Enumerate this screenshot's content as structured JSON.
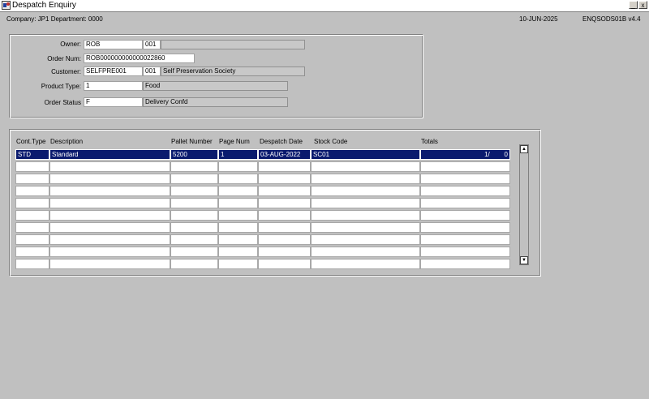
{
  "window": {
    "title": "Despatch Enquiry"
  },
  "status_bar": {
    "company": "Company:  JP1   Department:  0000",
    "date": "10-JUN-2025",
    "program": "ENQSODS01B  v4.4"
  },
  "header": {
    "owner": {
      "label": "Owner:",
      "code": "ROB",
      "num": "001",
      "desc": ""
    },
    "order_num": {
      "label": "Order Num:",
      "value": "ROB000000000000022860"
    },
    "customer": {
      "label": "Customer:",
      "code": "SELFPRE001",
      "num": "001",
      "desc": "Self Preservation Society"
    },
    "product_type": {
      "label": "Product Type:",
      "code": "1",
      "desc": "Food"
    },
    "order_status": {
      "label": "Order Status",
      "code": "F",
      "desc": "Delivery Confd"
    }
  },
  "table": {
    "columns": [
      "Cont.Type",
      "Description",
      "Pallet Number",
      "Page Num",
      "Despatch Date",
      "Stock Code",
      "Totals"
    ],
    "rows": [
      [
        "STD",
        "Standard",
        "5200",
        "1",
        "03-AUG-2022",
        "SC01",
        "1/        0"
      ],
      [
        "",
        "",
        "",
        "",
        "",
        "",
        ""
      ],
      [
        "",
        "",
        "",
        "",
        "",
        "",
        ""
      ],
      [
        "",
        "",
        "",
        "",
        "",
        "",
        ""
      ],
      [
        "",
        "",
        "",
        "",
        "",
        "",
        ""
      ],
      [
        "",
        "",
        "",
        "",
        "",
        "",
        ""
      ],
      [
        "",
        "",
        "",
        "",
        "",
        "",
        ""
      ],
      [
        "",
        "",
        "",
        "",
        "",
        "",
        ""
      ],
      [
        "",
        "",
        "",
        "",
        "",
        "",
        ""
      ],
      [
        "",
        "",
        "",
        "",
        "",
        "",
        ""
      ]
    ],
    "selected_row": 0
  },
  "icons": {
    "up": "▲",
    "down": "▼",
    "minimize": "_",
    "close": "x"
  },
  "colors": {
    "selection": "#0a1a6e"
  }
}
